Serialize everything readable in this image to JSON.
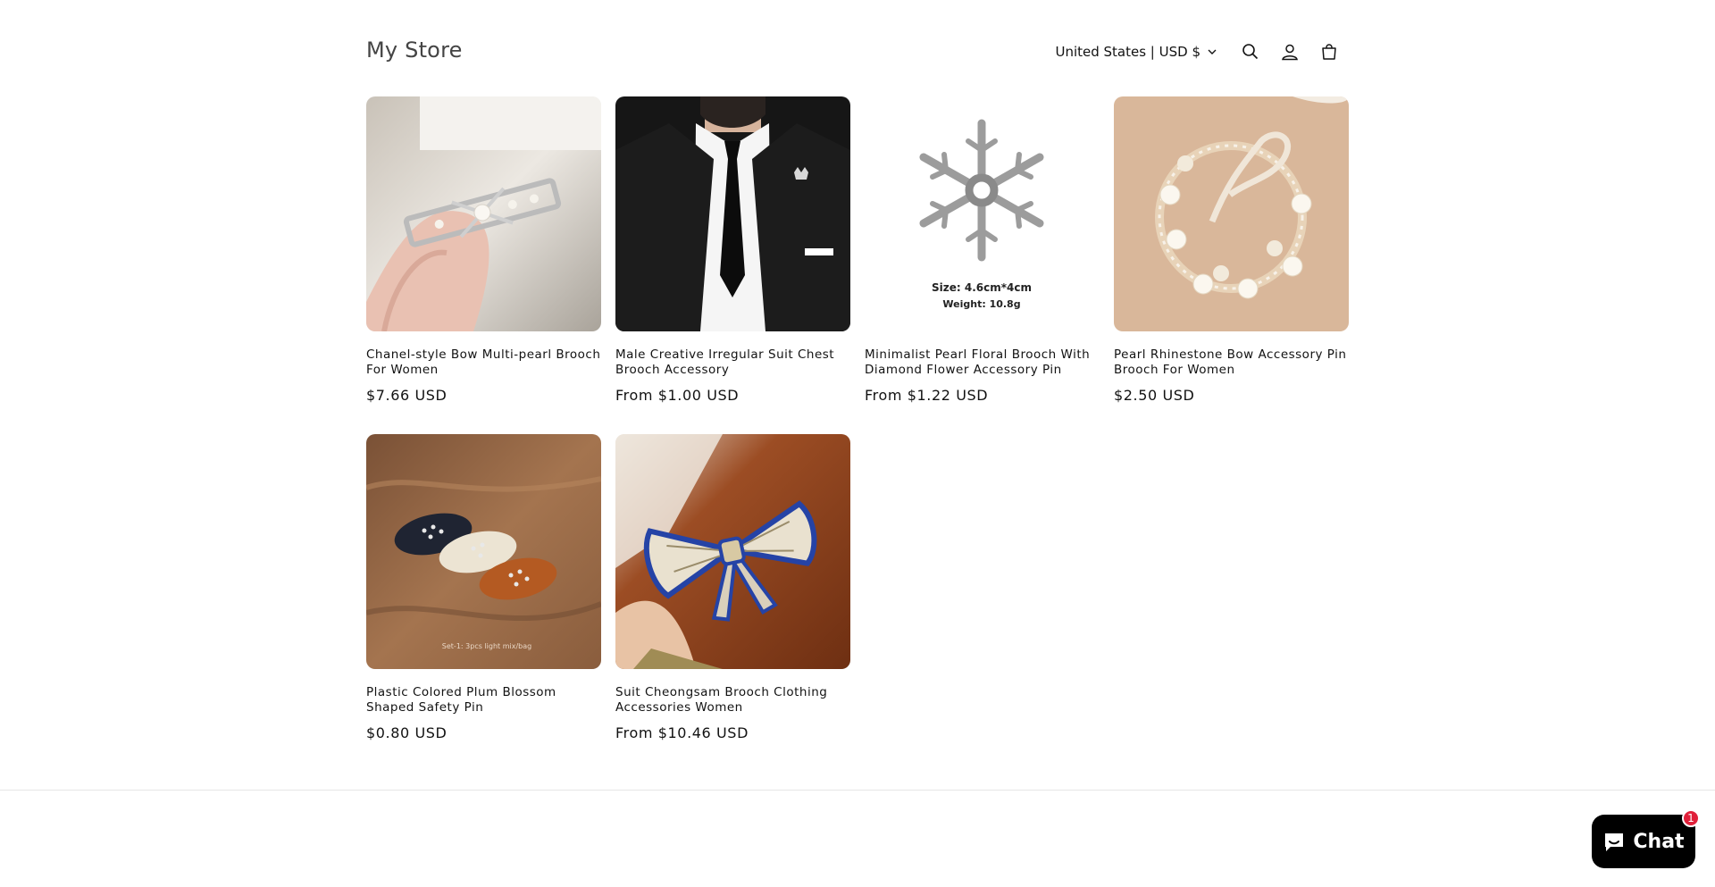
{
  "store": {
    "name": "My Store"
  },
  "header": {
    "locale": "United States | USD $"
  },
  "products": [
    {
      "title": "Chanel-style Bow Multi-pearl Brooch For Women",
      "price": "$7.66 USD"
    },
    {
      "title": "Male Creative Irregular Suit Chest Brooch Accessory",
      "price": "From $1.00 USD"
    },
    {
      "title": "Minimalist Pearl Floral Brooch With Diamond Flower Accessory Pin",
      "price": "From $1.22 USD",
      "image_caption_1": "Size: 4.6cm*4cm",
      "image_caption_2": "Weight: 10.8g"
    },
    {
      "title": "Pearl Rhinestone Bow Accessory Pin Brooch For Women",
      "price": "$2.50 USD"
    },
    {
      "title": "Plastic Colored Plum Blossom Shaped Safety Pin",
      "price": "$0.80 USD",
      "image_caption_1": "Set-1: 3pcs light mix/bag"
    },
    {
      "title": "Suit Cheongsam Brooch Clothing Accessories Women",
      "price": "From $10.46 USD"
    }
  ],
  "chat": {
    "label": "Chat",
    "badge": "1"
  },
  "icons": {
    "search": "search-icon",
    "account": "account-icon",
    "cart": "cart-icon",
    "locale_chevron": "chevron-down-icon",
    "chat": "chat-bubble-icon"
  }
}
